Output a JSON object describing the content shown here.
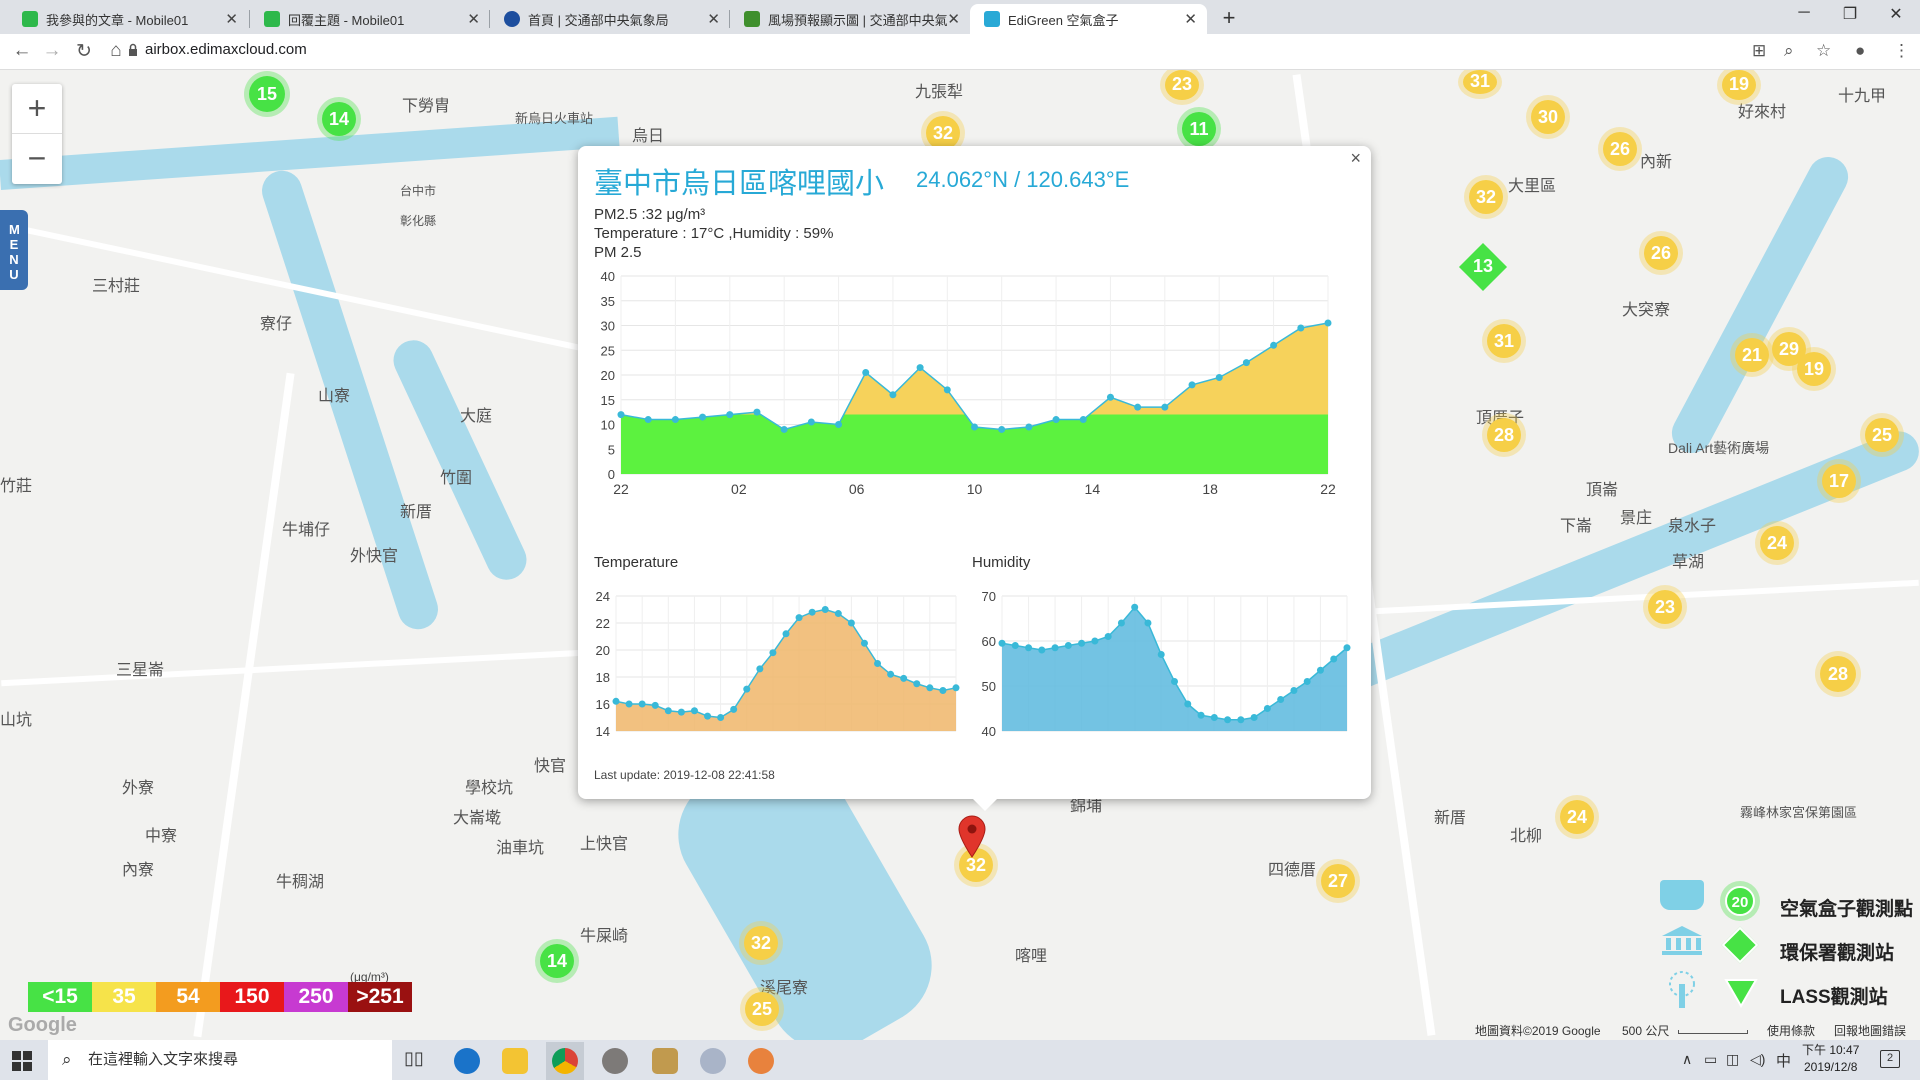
{
  "browser": {
    "tabs": [
      {
        "label": "我參與的文章 - Mobile01",
        "icon_color": "#2eb84b"
      },
      {
        "label": "回覆主題 - Mobile01",
        "icon_color": "#2eb84b"
      },
      {
        "label": "首頁 | 交通部中央氣象局",
        "icon_color": "#1d4e9e"
      },
      {
        "label": "風場預報顯示圖 | 交通部中央氣",
        "icon_color": "#3f8f2d"
      },
      {
        "label": "EdiGreen 空氣盒子",
        "icon_color": "#29a9d6"
      }
    ],
    "new_tab": "+",
    "url": "airbox.edimaxcloud.com"
  },
  "map": {
    "zoom_in": "+",
    "zoom_out": "−",
    "menu_label": "MENU",
    "places": [
      {
        "name": "下勞胄"
      },
      {
        "name": "新烏日火車站"
      },
      {
        "name": "烏日"
      },
      {
        "name": "九張犁"
      },
      {
        "name": "台中市"
      },
      {
        "name": "彰化縣"
      },
      {
        "name": "三村莊"
      },
      {
        "name": "寮仔"
      },
      {
        "name": "山寮"
      },
      {
        "name": "大庭"
      },
      {
        "name": "竹圍"
      },
      {
        "name": "新厝"
      },
      {
        "name": "牛埔仔"
      },
      {
        "name": "外快官"
      },
      {
        "name": "三星崙"
      },
      {
        "name": "外寮"
      },
      {
        "name": "中寮"
      },
      {
        "name": "內寮"
      },
      {
        "name": "學校坑"
      },
      {
        "name": "大崙墘"
      },
      {
        "name": "油車坑"
      },
      {
        "name": "牛稠湖"
      },
      {
        "name": "上快官"
      },
      {
        "name": "牛屎崎"
      },
      {
        "name": "溪尾寮"
      },
      {
        "name": "大里區"
      },
      {
        "name": "內新"
      },
      {
        "name": "大突寮"
      },
      {
        "name": "頂厝子"
      },
      {
        "name": "頂崙"
      },
      {
        "name": "下崙"
      },
      {
        "name": "景庄"
      },
      {
        "name": "泉水子"
      },
      {
        "name": "草湖"
      },
      {
        "name": "新厝"
      },
      {
        "name": "北柳"
      },
      {
        "name": "四德厝"
      },
      {
        "name": "喀哩"
      },
      {
        "name": "好來村"
      },
      {
        "name": "十九甲"
      },
      {
        "name": "竹莊"
      },
      {
        "name": "山坑"
      },
      {
        "name": "快官"
      },
      {
        "name": "錦埔"
      },
      {
        "name": "霧峰林家宮保第園區"
      },
      {
        "name": "Dali Art藝術廣場"
      }
    ],
    "markers": [
      {
        "value": "15"
      },
      {
        "value": "14"
      },
      {
        "value": "32"
      },
      {
        "value": "23"
      },
      {
        "value": "11"
      },
      {
        "value": "31"
      },
      {
        "value": "19"
      },
      {
        "value": "30"
      },
      {
        "value": "26"
      },
      {
        "value": "32"
      },
      {
        "value": "13"
      },
      {
        "value": "26"
      },
      {
        "value": "31"
      },
      {
        "value": "21"
      },
      {
        "value": "29"
      },
      {
        "value": "19"
      },
      {
        "value": "28"
      },
      {
        "value": "25"
      },
      {
        "value": "17"
      },
      {
        "value": "24"
      },
      {
        "value": "23"
      },
      {
        "value": "28"
      },
      {
        "value": "24"
      },
      {
        "value": "27"
      },
      {
        "value": "32"
      },
      {
        "value": "32"
      },
      {
        "value": "25"
      },
      {
        "value": "14"
      }
    ]
  },
  "popup": {
    "title": "臺中市烏日區喀哩國小",
    "coords": "24.062°N / 120.643°E",
    "pm25_line": "PM2.5 :32 μg/m³",
    "temp_humidity_line": "Temperature : 17°C ,Humidity : 59%",
    "chart1_title": "PM 2.5",
    "chart2_title": "Temperature",
    "chart3_title": "Humidity",
    "last_update": "Last update: 2019-12-08 22:41:58",
    "close": "×"
  },
  "chart_data": [
    {
      "type": "area",
      "title": "PM 2.5",
      "x_ticks": [
        "22",
        "02",
        "06",
        "10",
        "14",
        "18",
        "22"
      ],
      "ylim": [
        0,
        40
      ],
      "y_ticks": [
        0,
        5,
        10,
        15,
        20,
        25,
        30,
        35,
        40
      ],
      "values": [
        12,
        11,
        11,
        11.5,
        12,
        12.5,
        9,
        10.5,
        10,
        20.5,
        16,
        21.5,
        17,
        9.5,
        9,
        9.5,
        11,
        11,
        15.5,
        13.5,
        13.5,
        18,
        19.5,
        22.5,
        26,
        29.5,
        30.5
      ],
      "color_below_threshold": "#5cf23f",
      "color_above_threshold": "#f6d25b",
      "threshold": 12,
      "grid": true
    },
    {
      "type": "area",
      "title": "Temperature",
      "ylim": [
        14,
        24
      ],
      "y_ticks": [
        14,
        16,
        18,
        20,
        22,
        24
      ],
      "values": [
        16.2,
        16,
        16,
        15.9,
        15.5,
        15.4,
        15.5,
        15.1,
        15,
        15.6,
        17.1,
        18.6,
        19.8,
        21.2,
        22.4,
        22.8,
        23,
        22.7,
        22,
        20.5,
        19,
        18.2,
        17.9,
        17.5,
        17.2,
        17,
        17.2
      ],
      "color": "#f0b66a",
      "grid": true
    },
    {
      "type": "area",
      "title": "Humidity",
      "ylim": [
        40,
        70
      ],
      "y_ticks": [
        40,
        50,
        60,
        70
      ],
      "values": [
        59.5,
        59,
        58.5,
        58,
        58.5,
        59,
        59.5,
        60,
        61,
        64,
        67.5,
        64,
        57,
        51,
        46,
        43.5,
        43,
        42.5,
        42.5,
        43,
        45,
        47,
        49,
        51,
        53.5,
        56,
        58.5
      ],
      "color": "#5bb8de",
      "grid": true
    }
  ],
  "legend": {
    "unit": "(μg/m³)",
    "items": [
      {
        "label": "<15",
        "color": "#47e245"
      },
      {
        "label": "35",
        "color": "#f6e34a"
      },
      {
        "label": "54",
        "color": "#f39c1f"
      },
      {
        "label": "150",
        "color": "#e8181b"
      },
      {
        "label": "250",
        "color": "#c73ad1"
      },
      {
        "label": ">251",
        "color": "#9a1111"
      }
    ]
  },
  "station_keys": [
    {
      "label": "空氣盒子觀測點",
      "icon": "airbox-station-icon"
    },
    {
      "label": "環保署觀測站",
      "icon": "epa-station-icon"
    },
    {
      "label": "LASS觀測站",
      "icon": "lass-station-icon"
    }
  ],
  "station_key_sample_value": "20",
  "attribution": {
    "map_data": "地圖資料©2019 Google",
    "scale": "500 公尺",
    "terms": "使用條款",
    "report": "回報地圖錯誤"
  },
  "google_logo": "Google",
  "taskbar": {
    "search_placeholder": "在這裡輸入文字來搜尋",
    "time": "下午 10:47",
    "date": "2019/12/8",
    "ime": "中",
    "notification_count": "2"
  }
}
